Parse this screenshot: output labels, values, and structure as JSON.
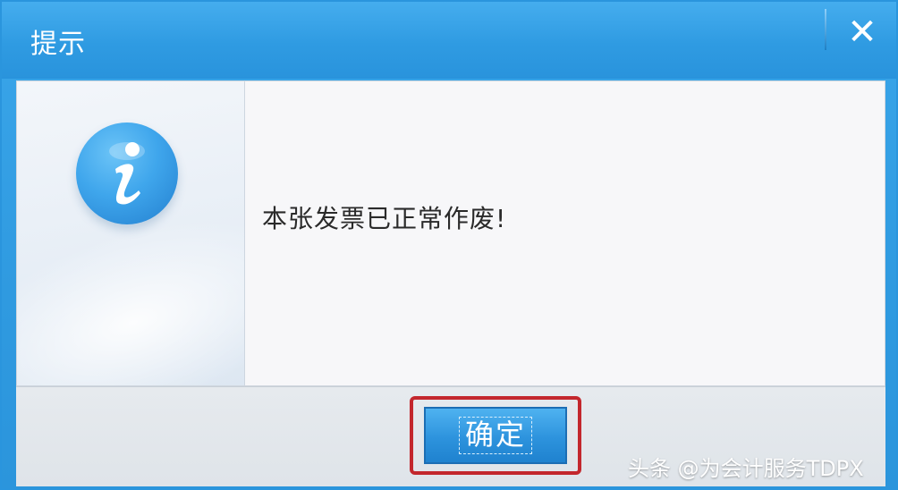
{
  "dialog": {
    "title": "提示",
    "close_symbol": "✕",
    "icon": "info-icon",
    "message": "本张发票已正常作废!",
    "ok_label": "确定"
  },
  "watermark": "头条 @为会计服务TDPX",
  "colors": {
    "titlebar": "#2f9be0",
    "button": "#2d93dd",
    "highlight_border": "#c3272d",
    "content_bg": "#f7f7f9"
  }
}
